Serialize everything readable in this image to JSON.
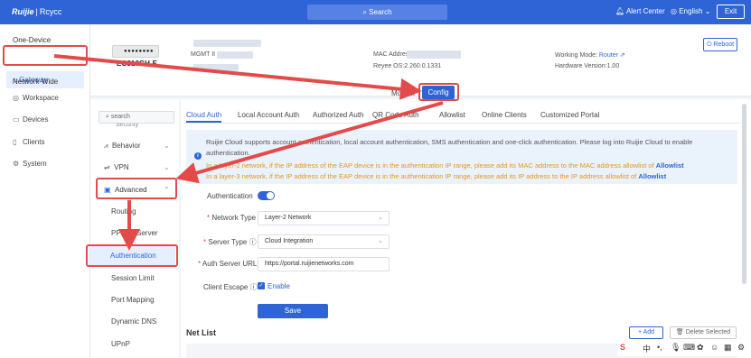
{
  "topbar": {
    "logo": "Ruijie",
    "logo_sep": "|",
    "logo_sub": "Rcycc",
    "search": "Search",
    "alert": "Alert Center",
    "language": "English",
    "exit": "Exit"
  },
  "sidenav": {
    "one_device": "One-Device",
    "gateway": "Gateway",
    "network_wide": "Network-Wide",
    "workspace": "Workspace",
    "devices": "Devices",
    "clients": "Clients",
    "system": "System"
  },
  "device": {
    "model": "EG310GH-E",
    "mgmt_label": "MGMT II",
    "mac_label": "MAC Addres",
    "os": "Reyee OS:2.260.0.1331",
    "working_mode_label": "Working Mode:",
    "working_mode_value": "Router",
    "hardware": "Hardware Version:1.00",
    "reboot": "Reboot",
    "monitor": "Monitor",
    "config": "Config"
  },
  "submenu": {
    "search_placeholder": "search",
    "security": "Security",
    "behavior": "Behavior",
    "vpn": "VPN",
    "advanced": "Advanced",
    "routing": "Routing",
    "pppoe_server": "PPPoE Server",
    "authentication": "Authentication",
    "session_limit": "Session Limit",
    "port_mapping": "Port Mapping",
    "dynamic_dns": "Dynamic DNS",
    "upnp": "UPnP"
  },
  "tabs": [
    "Cloud Auth",
    "Local Account Auth",
    "Authorized Auth",
    "QR Code Auth",
    "Allowlist",
    "Online Clients",
    "Customized Portal"
  ],
  "notice": {
    "line1": "Ruijie Cloud supports account authentication, local account authentication, SMS authentication and one-click authentication. Please log into Ruijie Cloud to enable",
    "line2": "authentication.",
    "line3": "In a layer-2 network, if the IP address of the EAP device is in the authentication IP range, please add its MAC address to the MAC address allowlist of",
    "line4": "In a layer-3 network, if the IP address of the EAP device is in the authentication IP range, please add its IP address to the IP address allowlist of",
    "link": "Allowlist"
  },
  "form": {
    "authentication_label": "Authentication",
    "network_type_label": "Network Type",
    "network_type_value": "Layer-2 Network",
    "server_type_label": "Server Type",
    "server_type_value": "Cloud Integration",
    "auth_url_label": "Auth Server URL",
    "auth_url_value": "https://portal.ruijienetworks.com",
    "client_escape_label": "Client Escape",
    "client_escape_value": "Enable",
    "save": "Save"
  },
  "netlist": {
    "title": "Net List",
    "add": "Add",
    "delete": "Delete Selected"
  },
  "ime": {
    "zh": "中"
  },
  "colors": {
    "accent": "#2e64d6",
    "annotation": "#e34b4b",
    "warning": "#e69520"
  }
}
